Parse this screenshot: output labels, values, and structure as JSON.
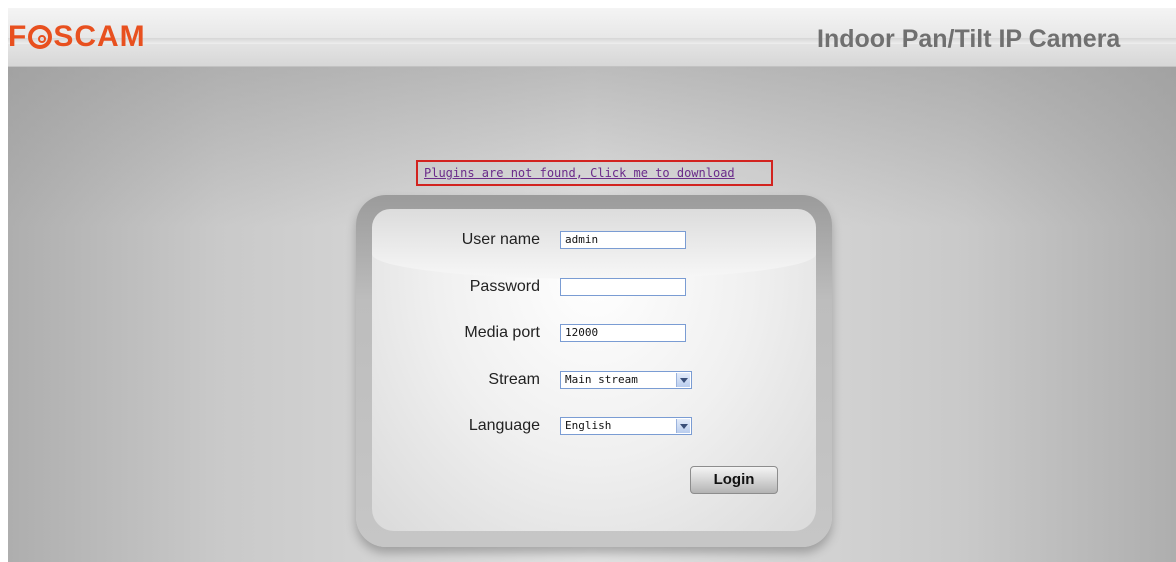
{
  "header": {
    "logo_text": "FOSCAM",
    "logo_prefix": "F",
    "logo_suffix": "SCAM",
    "title": "Indoor Pan/Tilt IP Camera",
    "colors": {
      "logo": "#e8501f",
      "title": "#707070"
    }
  },
  "plugin_notice": {
    "text": "Plugins are not found, Click me to download",
    "border_color": "#d2231f",
    "link_color": "#6a2b8a"
  },
  "login_form": {
    "fields": {
      "username": {
        "label": "User name",
        "value": "admin"
      },
      "password": {
        "label": "Password",
        "value": ""
      },
      "media_port": {
        "label": "Media port",
        "value": "12000"
      },
      "stream": {
        "label": "Stream",
        "value": "Main stream"
      },
      "language": {
        "label": "Language",
        "value": "English"
      }
    },
    "submit_label": "Login"
  },
  "icons": {
    "stream_dropdown": "chevron-down-icon",
    "language_dropdown": "chevron-down-icon"
  }
}
